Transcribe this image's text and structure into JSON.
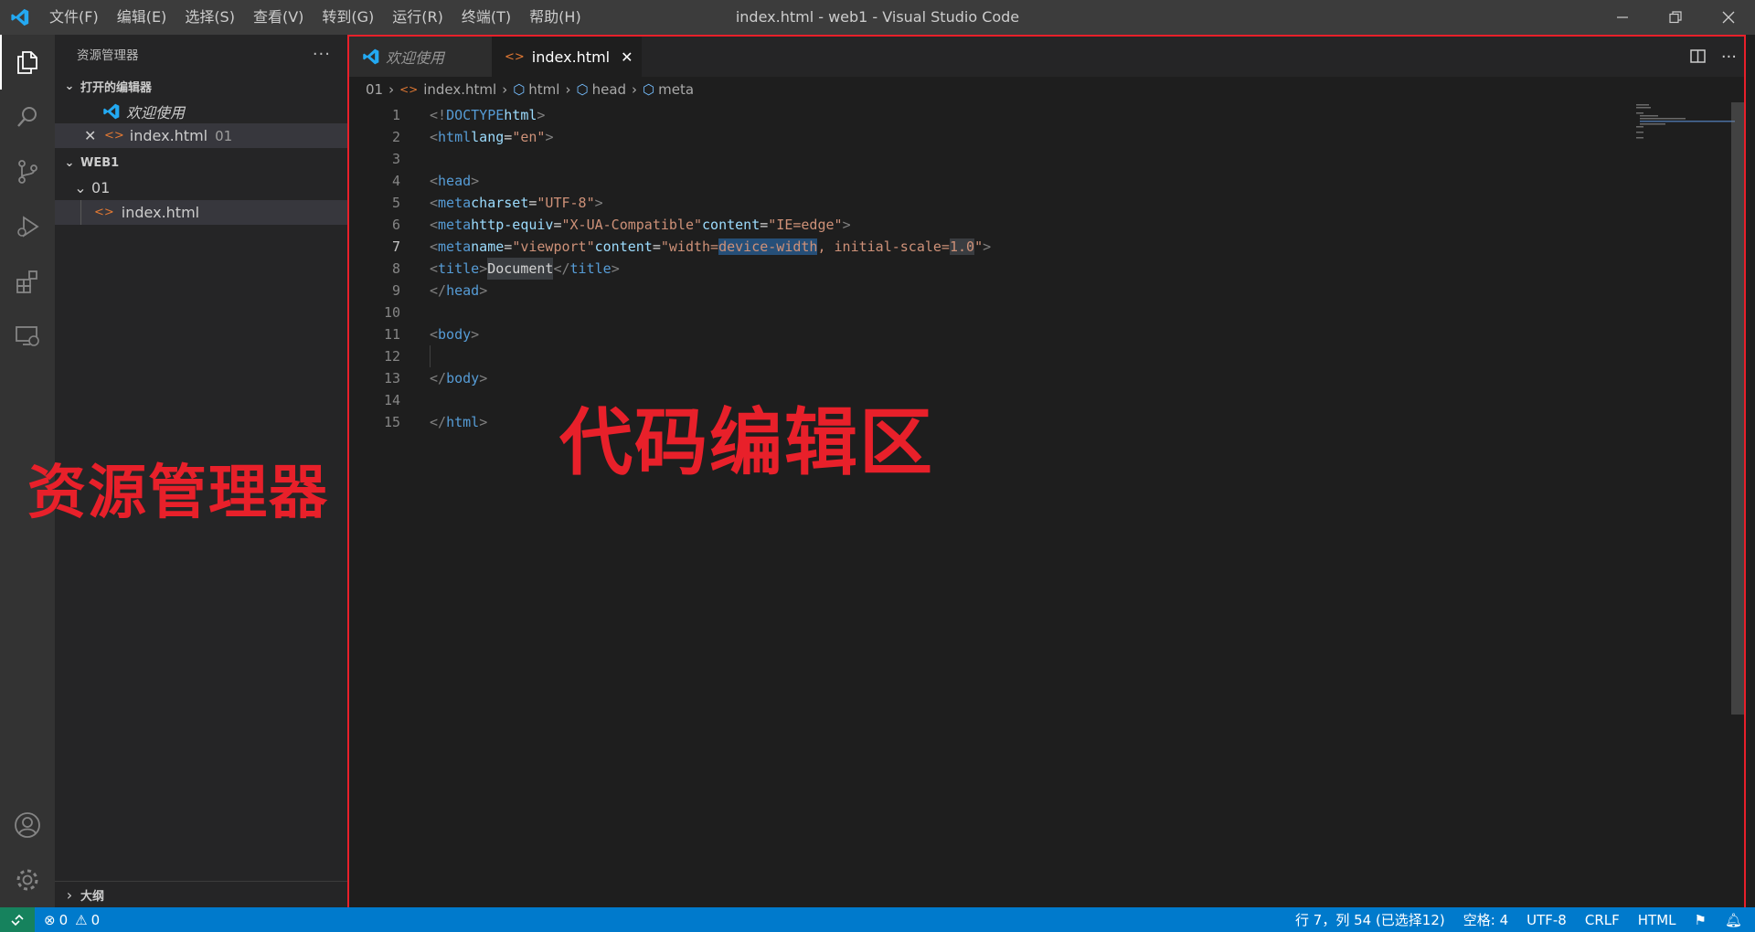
{
  "titlebar": {
    "menu": [
      "文件(F)",
      "编辑(E)",
      "选择(S)",
      "查看(V)",
      "转到(G)",
      "运行(R)",
      "终端(T)",
      "帮助(H)"
    ],
    "window_title": "index.html - web1 - Visual Studio Code"
  },
  "activitybar": {
    "items": [
      "files-icon",
      "search-icon",
      "source-control-icon",
      "run-debug-icon",
      "extensions-icon",
      "remote-explorer-icon"
    ],
    "bottom": [
      "account-icon",
      "settings-gear-icon"
    ]
  },
  "sidebar": {
    "title": "资源管理器",
    "open_editors": {
      "header": "打开的编辑器",
      "items": [
        {
          "label": "欢迎使用",
          "suffix": ""
        },
        {
          "label": "index.html",
          "suffix": "01"
        }
      ]
    },
    "workspace": {
      "header": "WEB1",
      "folder": "01",
      "file": "index.html"
    },
    "outline_header": "大纲"
  },
  "annotations": {
    "sidebar_label": "资源管理器",
    "editor_label": "代码编辑区"
  },
  "editor": {
    "tabs": [
      {
        "label": "欢迎使用",
        "active": false
      },
      {
        "label": "index.html",
        "active": true
      }
    ],
    "breadcrumb": [
      "01",
      "index.html",
      "html",
      "head",
      "meta"
    ],
    "line_numbers": [
      "1",
      "2",
      "3",
      "4",
      "5",
      "6",
      "7",
      "8",
      "9",
      "10",
      "11",
      "12",
      "13",
      "14",
      "15"
    ],
    "current_line": 7
  },
  "statusbar": {
    "errors": "0",
    "warnings": "0",
    "position": "行 7，列 54 (已选择12)",
    "indent": "空格: 4",
    "encoding": "UTF-8",
    "eol": "CRLF",
    "language": "HTML"
  },
  "colors": {
    "accent": "#007acc",
    "annotation_red": "#e8202a",
    "html_icon": "#e37933",
    "vscode_blue": "#23a9f2"
  }
}
